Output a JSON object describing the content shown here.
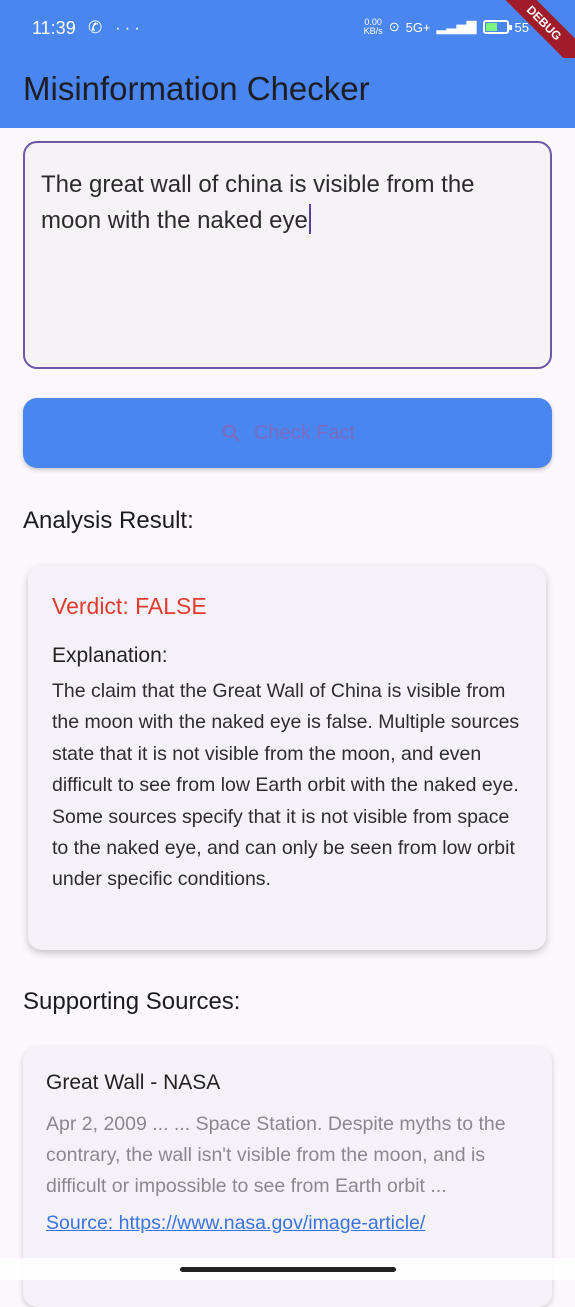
{
  "status": {
    "time": "11:39",
    "left_icons": "✆ ···",
    "speed": "0.00",
    "speed_unit": "KB/s",
    "network": "5G+",
    "battery_level": "55",
    "battery_fraction": 0.55
  },
  "debug_banner": "DEBUG",
  "app_bar": {
    "title": "Misinformation Checker"
  },
  "input": {
    "value": "The great wall of china is visible from the moon with the naked eye"
  },
  "check_button": {
    "label": "Check Fact",
    "icon": "search-icon"
  },
  "analysis": {
    "heading": "Analysis Result:",
    "verdict": "Verdict: FALSE",
    "explanation_title": "Explanation:",
    "explanation": "The claim that the Great Wall of China is visible from the moon with the naked eye is false. Multiple sources state that it is not visible from the moon, and even difficult to see from low Earth orbit with the naked eye. Some sources specify that it is not visible from space to the naked eye, and can only be seen from low orbit under specific conditions."
  },
  "sources": {
    "heading": "Supporting Sources:",
    "items": [
      {
        "title": "Great Wall - NASA",
        "snippet": "Apr 2, 2009 ... ... Space Station. Despite myths to the contrary, the wall isn't visible from the moon, and is difficult or impossible to see from Earth orbit ...",
        "link": "Source: https://www.nasa.gov/image-article/"
      }
    ]
  },
  "colors": {
    "app_bar": "#4a86f0",
    "background": "#fcf6fd",
    "verdict_false": "#e33b2f",
    "input_border": "#6e57a8",
    "link": "#3a73e0"
  }
}
